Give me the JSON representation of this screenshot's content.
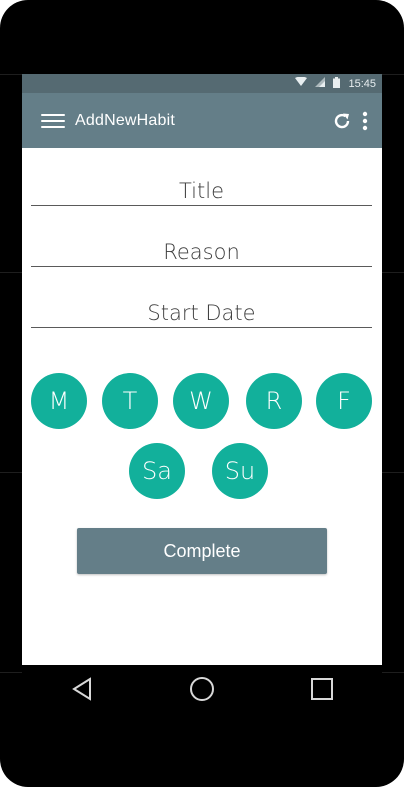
{
  "status_bar": {
    "time": "15:45",
    "icons": [
      "wifi-icon",
      "signal-icon",
      "battery-icon"
    ]
  },
  "app_bar": {
    "title": "AddNewHabit",
    "icons": [
      "menu-icon",
      "refresh-icon",
      "overflow-menu-icon"
    ]
  },
  "form": {
    "title_placeholder": "Title",
    "reason_placeholder": "Reason",
    "start_date_placeholder": "Start Date"
  },
  "days": [
    {
      "label": "M"
    },
    {
      "label": "T"
    },
    {
      "label": "W"
    },
    {
      "label": "R"
    },
    {
      "label": "F"
    },
    {
      "label": "Sa"
    },
    {
      "label": "Su"
    }
  ],
  "complete_button": {
    "label": "Complete"
  },
  "nav_bar": {
    "icons": [
      "back-icon",
      "home-icon",
      "recents-icon"
    ]
  },
  "colors": {
    "status_bar": "#556a72",
    "app_bar": "#647e88",
    "day_circle": "#12b09b",
    "button": "#647e88"
  }
}
